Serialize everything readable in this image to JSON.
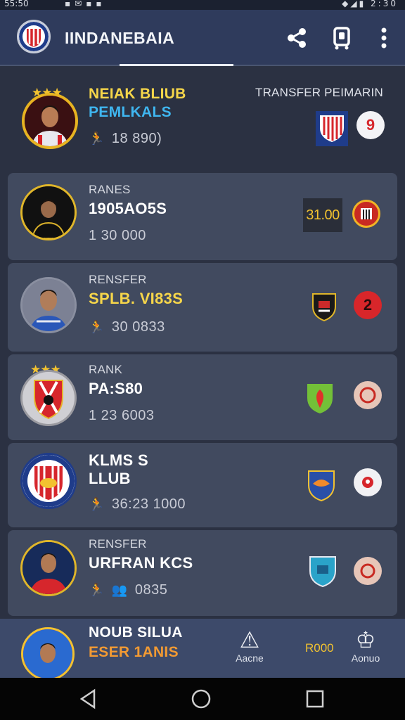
{
  "status_bar": {
    "time": "55:50",
    "right": "2:30"
  },
  "app_bar": {
    "title": "IINDANEBAIA"
  },
  "rows": [
    {
      "label_small": "NEIAK BLIUB",
      "label_big": "PEMLKALS",
      "stat": "18  890)",
      "side_label": "TRANSFER PEIMARIN",
      "badge": "9"
    },
    {
      "label_small": "RANES",
      "label_big": "1905AO5S",
      "stat": "1  30  000",
      "price": "31.00"
    },
    {
      "label_small": "RENSFER",
      "label_big": "SPLB. VI83S",
      "stat": "30  0833",
      "badge": "2"
    },
    {
      "label_small": "RANK",
      "label_big": "PA:S80",
      "stat": "1  23  6003"
    },
    {
      "label_small": "KLMS  S",
      "label_big": "LLUB",
      "stat": "36:23 1000"
    },
    {
      "label_small": "RENSFER",
      "label_big": "URFRAN KCS",
      "stat": "0835"
    }
  ],
  "bottom_row": {
    "label_top": "NOUB SILUA",
    "label_bottom": "ESER 1ANIS",
    "action_left": "Aacne",
    "price": "R000",
    "action_right": "Aonuo"
  },
  "colors": {
    "accent_yellow": "#f2c230",
    "accent_blue": "#3fb6f0",
    "badge_red": "#e0262a"
  }
}
